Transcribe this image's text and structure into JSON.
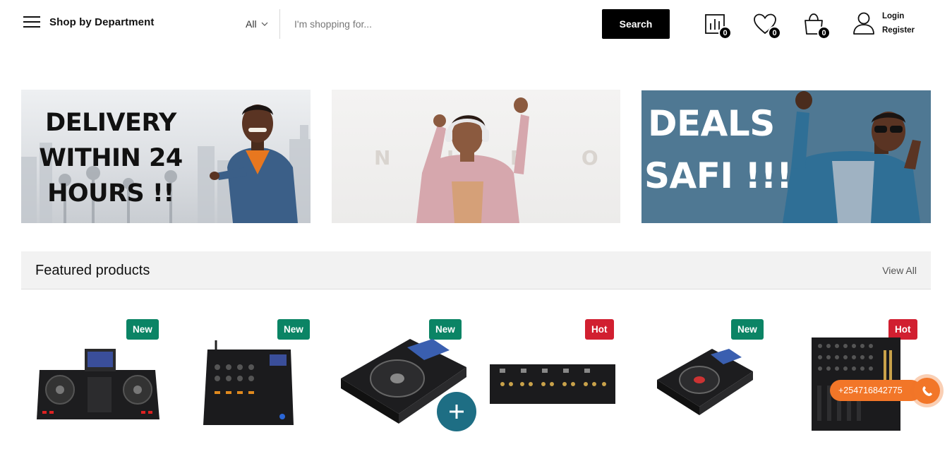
{
  "header": {
    "department_label": "Shop by Department",
    "category_selected": "All",
    "search_placeholder": "I'm shopping for...",
    "search_button": "Search",
    "compare_count": "0",
    "wishlist_count": "0",
    "cart_count": "0",
    "login_label": "Login",
    "register_label": "Register"
  },
  "banners": {
    "delivery_line1": "DELIVERY",
    "delivery_line2": "WITHIN 24",
    "delivery_line3": "HOURS !!",
    "middle_letters": "N  I  R  O  B  I",
    "deals_line1": "DEALS",
    "deals_line2": "SAFI !!!"
  },
  "featured": {
    "title": "Featured products",
    "view_all": "View All"
  },
  "products": [
    {
      "tag": "New",
      "tag_type": "new",
      "icon": "dj-controller-icon"
    },
    {
      "tag": "New",
      "tag_type": "new",
      "icon": "dj-mixer-icon"
    },
    {
      "tag": "New",
      "tag_type": "new",
      "icon": "cdj-player-icon"
    },
    {
      "tag": "Hot",
      "tag_type": "hot",
      "icon": "rack-mixer-icon"
    },
    {
      "tag": "New",
      "tag_type": "new",
      "icon": "cdj-player-icon"
    },
    {
      "tag": "Hot",
      "tag_type": "hot",
      "icon": "large-mixer-icon"
    }
  ],
  "floating": {
    "phone_number": "+254716842775"
  },
  "colors": {
    "tag_new": "#0b8465",
    "tag_hot": "#d11f30",
    "deals_banner": "#4f7893",
    "phone_orange": "#f27628",
    "plus_button": "#1e6e84"
  }
}
